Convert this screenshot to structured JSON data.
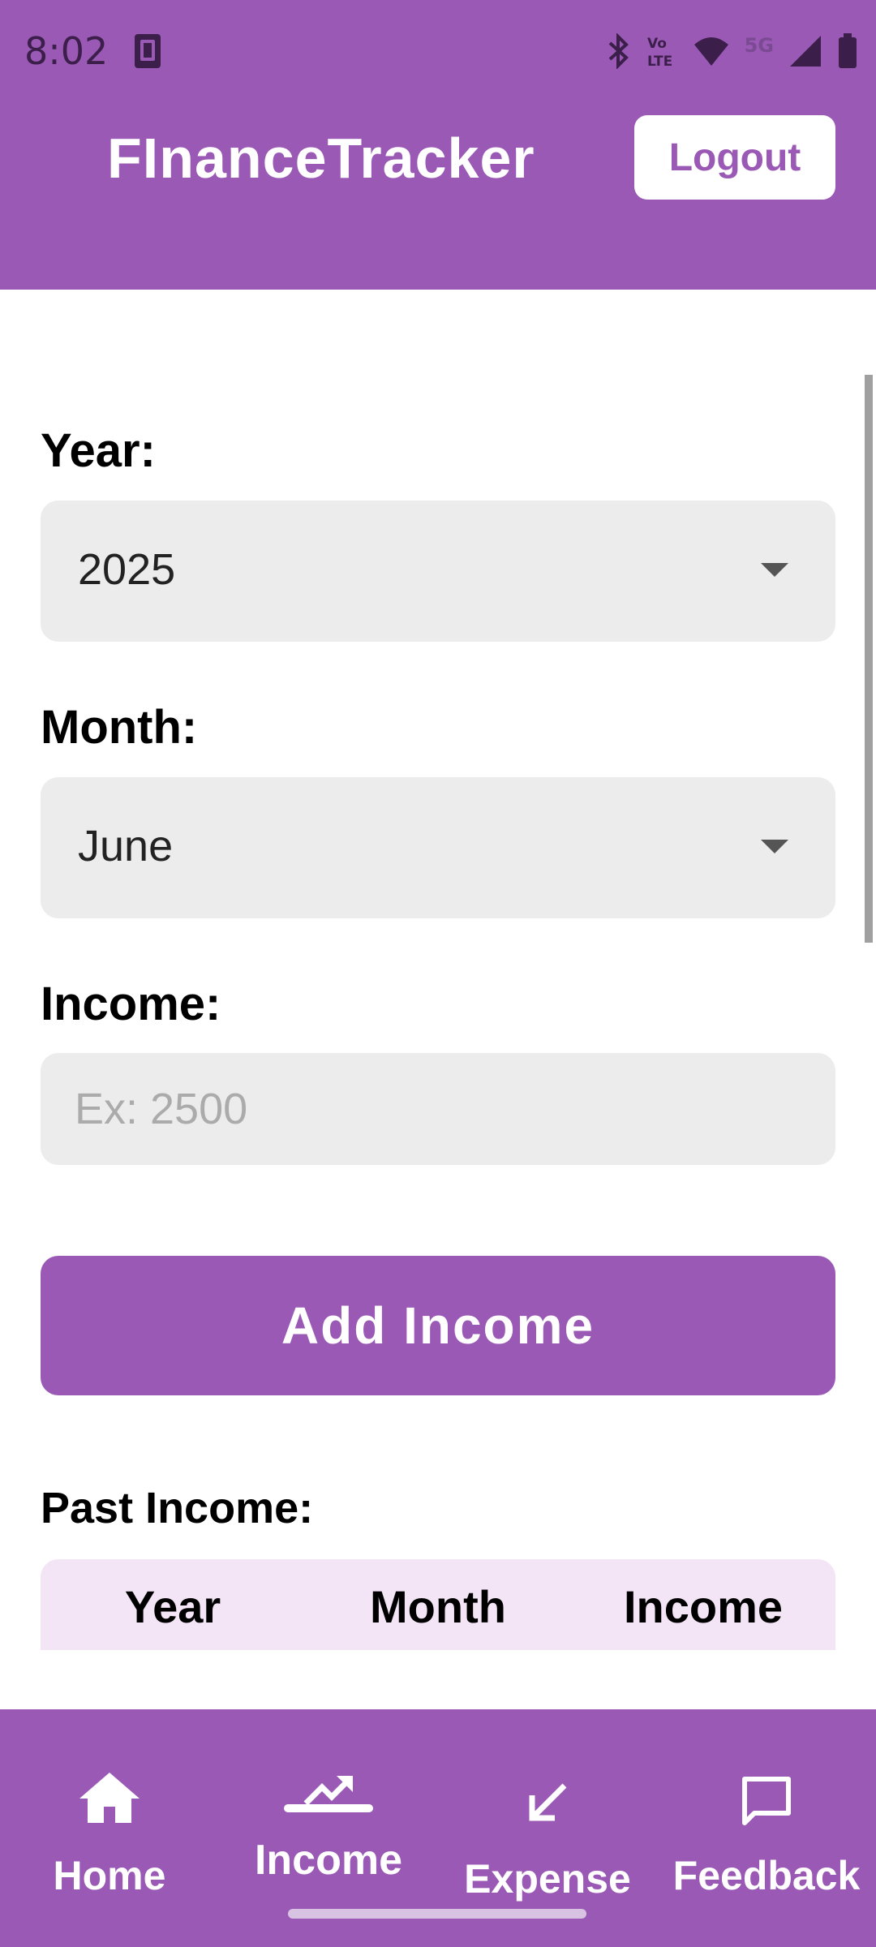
{
  "status_bar": {
    "time": "8:02",
    "network_label": "5G",
    "icons": [
      "sim-card-icon",
      "bluetooth-icon",
      "volte-icon",
      "wifi-icon",
      "signal-icon",
      "battery-icon"
    ]
  },
  "header": {
    "title": "FInanceTracker",
    "logout_label": "Logout"
  },
  "form": {
    "year_label": "Year:",
    "year_value": "2025",
    "month_label": "Month:",
    "month_value": "June",
    "income_label": "Income:",
    "income_value": "",
    "income_placeholder": "Ex: 2500",
    "add_button_label": "Add Income"
  },
  "past_income": {
    "title": "Past Income:",
    "columns": [
      "Year",
      "Month",
      "Income"
    ]
  },
  "bottom_nav": {
    "items": [
      {
        "label": "Home",
        "icon": "home-icon"
      },
      {
        "label": "Income",
        "icon": "trending-up-icon",
        "active": true
      },
      {
        "label": "Expense",
        "icon": "arrow-down-left-icon"
      },
      {
        "label": "Feedback",
        "icon": "chat-bubble-icon"
      }
    ]
  },
  "colors": {
    "primary": "#9b59b6",
    "field_bg": "#ececec",
    "table_header_bg": "#f3e5f5"
  }
}
